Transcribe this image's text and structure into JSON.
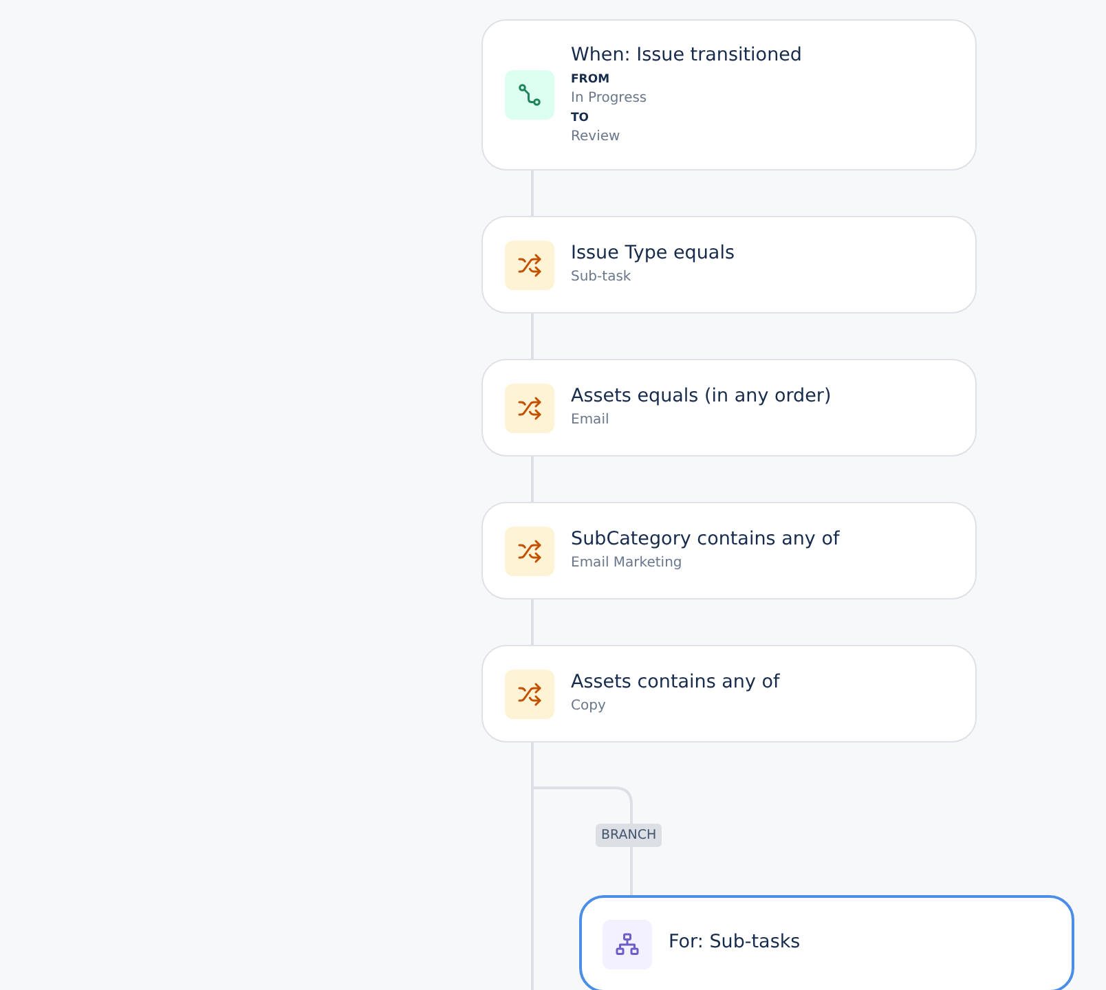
{
  "steps": [
    {
      "kind": "trigger",
      "title": "When: Issue transitioned",
      "selected": false,
      "details": [
        {
          "kind": "label",
          "text": "FROM"
        },
        {
          "kind": "value",
          "text": "In Progress"
        },
        {
          "kind": "label",
          "text": "TO"
        },
        {
          "kind": "value",
          "text": "Review"
        }
      ]
    },
    {
      "kind": "condition",
      "title": "Issue Type equals",
      "selected": false,
      "details": [
        {
          "kind": "value",
          "text": "Sub-task"
        }
      ]
    },
    {
      "kind": "condition",
      "title": "Assets equals (in any order)",
      "selected": false,
      "details": [
        {
          "kind": "value",
          "text": "Email"
        }
      ]
    },
    {
      "kind": "condition",
      "title": "SubCategory contains any of",
      "selected": false,
      "details": [
        {
          "kind": "value",
          "text": "Email Marketing"
        }
      ]
    },
    {
      "kind": "condition",
      "title": "Assets contains any of",
      "selected": false,
      "details": [
        {
          "kind": "value",
          "text": "Copy"
        }
      ]
    }
  ],
  "branch": {
    "label": "BRANCH",
    "card": {
      "kind": "branch",
      "title": "For: Sub-tasks",
      "selected": true
    }
  }
}
